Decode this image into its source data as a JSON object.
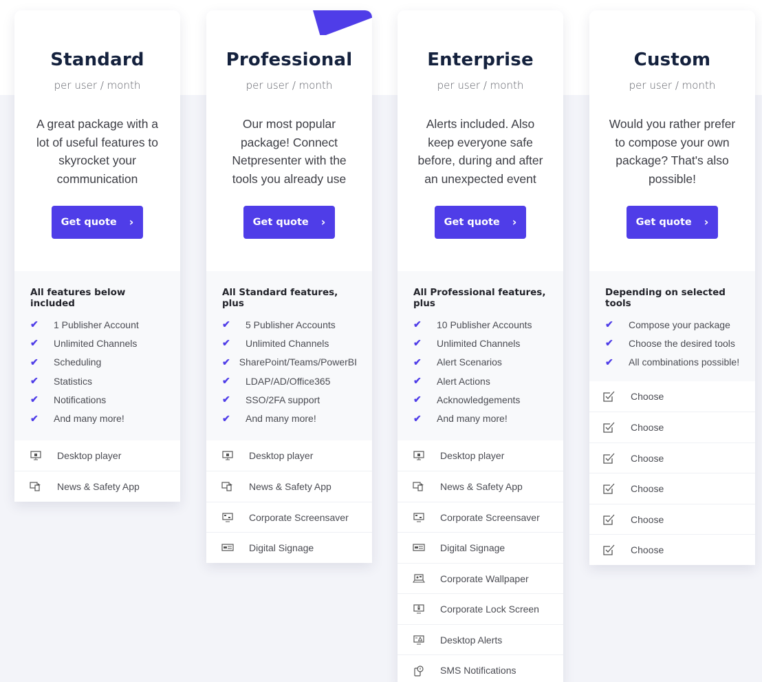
{
  "theme": {
    "accent": "#4f3de8",
    "title_color": "#14213d",
    "page_bg": "#f3f4f9",
    "features_bg": "#f8f9fb"
  },
  "plans": [
    {
      "name": "Standard",
      "period": "per user / month",
      "description": "A great package with a lot of useful features to skyrocket your communication",
      "cta_label": "Get quote",
      "features_title": "All features below included",
      "features": [
        "1 Publisher Account",
        "Unlimited Channels",
        "Scheduling",
        "Statistics",
        "Notifications",
        "And many more!"
      ],
      "tools": [
        {
          "icon": "desktop-player-icon",
          "label": "Desktop player"
        },
        {
          "icon": "news-safety-app-icon",
          "label": "News & Safety App"
        }
      ]
    },
    {
      "name": "Professional",
      "period": "per user / month",
      "description": "Our most popular package! Connect Netpresenter with the tools you already use",
      "cta_label": "Get quote",
      "featured": true,
      "features_title": "All Standard features, plus",
      "features": [
        "5 Publisher Accounts",
        "Unlimited Channels",
        "SharePoint/Teams/PowerBI",
        "LDAP/AD/Office365",
        "SSO/2FA support",
        "And many more!"
      ],
      "tools": [
        {
          "icon": "desktop-player-icon",
          "label": "Desktop player"
        },
        {
          "icon": "news-safety-app-icon",
          "label": "News & Safety App"
        },
        {
          "icon": "corporate-screensaver-icon",
          "label": "Corporate Screensaver"
        },
        {
          "icon": "digital-signage-icon",
          "label": "Digital Signage"
        }
      ]
    },
    {
      "name": "Enterprise",
      "period": "per user / month",
      "description": "Alerts included. Also keep everyone safe before, during and after an unexpected event",
      "cta_label": "Get quote",
      "features_title": "All Professional features, plus",
      "features": [
        "10 Publisher Accounts",
        "Unlimited Channels",
        "Alert Scenarios",
        "Alert Actions",
        "Acknowledgements",
        "And many more!"
      ],
      "tools": [
        {
          "icon": "desktop-player-icon",
          "label": "Desktop player"
        },
        {
          "icon": "news-safety-app-icon",
          "label": "News & Safety App"
        },
        {
          "icon": "corporate-screensaver-icon",
          "label": "Corporate Screensaver"
        },
        {
          "icon": "digital-signage-icon",
          "label": "Digital Signage"
        },
        {
          "icon": "corporate-wallpaper-icon",
          "label": "Corporate Wallpaper"
        },
        {
          "icon": "corporate-lock-screen-icon",
          "label": "Corporate Lock Screen"
        },
        {
          "icon": "desktop-alerts-icon",
          "label": "Desktop Alerts"
        },
        {
          "icon": "sms-notifications-icon",
          "label": "SMS Notifications"
        }
      ]
    },
    {
      "name": "Custom",
      "period": "per user / month",
      "description": "Would you rather prefer to compose your own package? That's also possible!",
      "cta_label": "Get quote",
      "features_title": "Depending on selected tools",
      "features": [
        "Compose your package",
        "Choose the desired tools",
        "All combinations possible!"
      ],
      "tools": [
        {
          "icon": "checkbox-icon",
          "label": "Choose"
        },
        {
          "icon": "checkbox-icon",
          "label": "Choose"
        },
        {
          "icon": "checkbox-icon",
          "label": "Choose"
        },
        {
          "icon": "checkbox-icon",
          "label": "Choose"
        },
        {
          "icon": "checkbox-icon",
          "label": "Choose"
        },
        {
          "icon": "checkbox-icon",
          "label": "Choose"
        }
      ]
    }
  ]
}
